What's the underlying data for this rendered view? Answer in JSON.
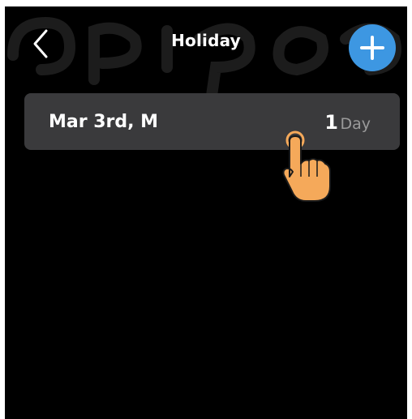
{
  "header": {
    "back_icon": "chevron-left-icon",
    "title": "Holiday",
    "add_icon": "plus-icon"
  },
  "holidays": [
    {
      "date": "Mar 3rd, M",
      "count": "1",
      "unit": "Day"
    }
  ],
  "colors": {
    "background": "#000000",
    "card": "#3a3a3c",
    "accent": "#3d97e2",
    "muted_text": "#9a9a9a",
    "hand": "#f5a95a"
  }
}
